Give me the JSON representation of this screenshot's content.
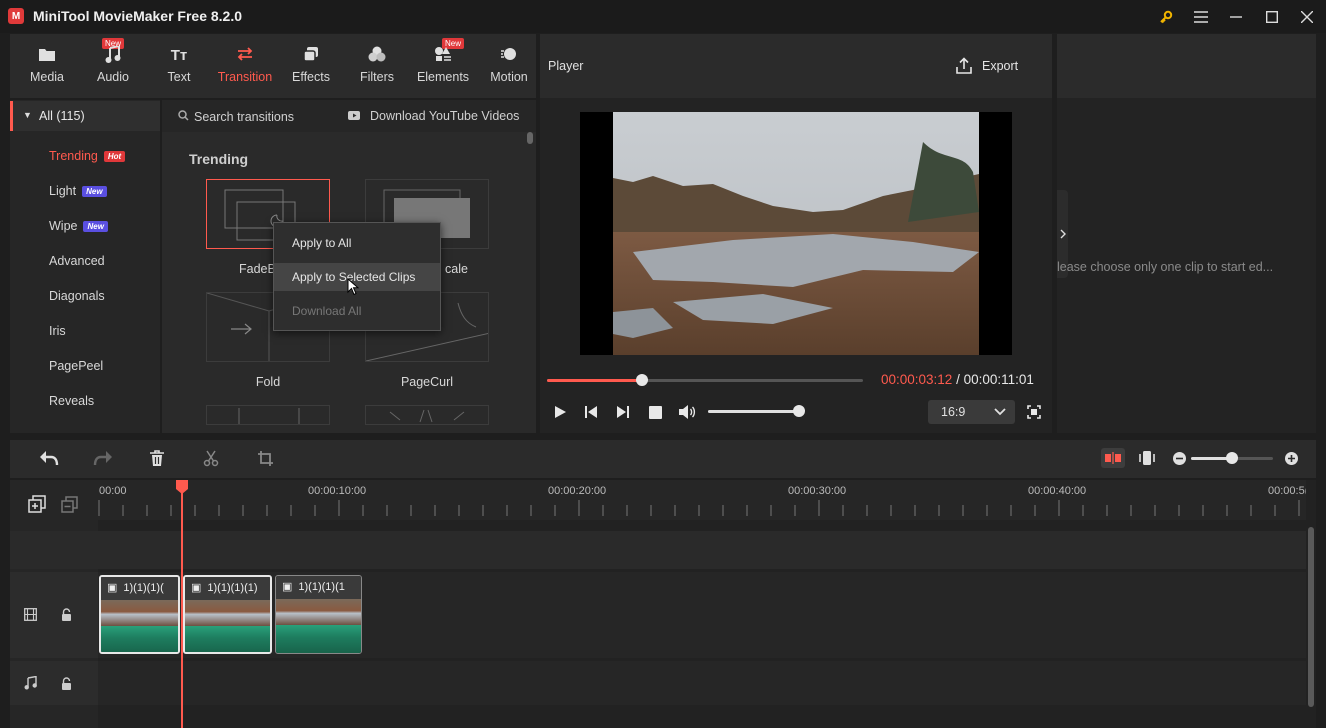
{
  "app": {
    "title": "MiniTool MovieMaker Free 8.2.0",
    "logo": "M"
  },
  "window_controls": {
    "key": "key-icon",
    "menu": "hamburger-icon"
  },
  "toolbar": {
    "tabs": [
      {
        "label": "Media",
        "icon": "media-icon",
        "badge": ""
      },
      {
        "label": "Audio",
        "icon": "audio-icon",
        "badge": "New"
      },
      {
        "label": "Text",
        "icon": "text-icon",
        "badge": ""
      },
      {
        "label": "Transition",
        "icon": "transition-icon",
        "badge": "",
        "active": true
      },
      {
        "label": "Effects",
        "icon": "effects-icon",
        "badge": ""
      },
      {
        "label": "Filters",
        "icon": "filters-icon",
        "badge": ""
      },
      {
        "label": "Elements",
        "icon": "elements-icon",
        "badge": "New"
      },
      {
        "label": "Motion",
        "icon": "motion-icon",
        "badge": ""
      }
    ]
  },
  "categories": {
    "all": "All (115)",
    "items": [
      {
        "label": "Trending",
        "tag": "Hot"
      },
      {
        "label": "Light",
        "tag": "New"
      },
      {
        "label": "Wipe",
        "tag": "New"
      },
      {
        "label": "Advanced",
        "tag": ""
      },
      {
        "label": "Diagonals",
        "tag": ""
      },
      {
        "label": "Iris",
        "tag": ""
      },
      {
        "label": "PagePeel",
        "tag": ""
      },
      {
        "label": "Reveals",
        "tag": ""
      }
    ]
  },
  "library": {
    "search_placeholder": "Search transitions",
    "download_link": "Download YouTube Videos",
    "section_title": "Trending",
    "items": [
      {
        "label": "FadeB"
      },
      {
        "label": "cale"
      },
      {
        "label": "Fold"
      },
      {
        "label": "PageCurl"
      }
    ]
  },
  "context_menu": {
    "items": [
      {
        "label": "Apply to All",
        "enabled": true
      },
      {
        "label": "Apply to Selected Clips",
        "enabled": true,
        "hover": true
      },
      {
        "label": "Download All",
        "enabled": false
      }
    ]
  },
  "player": {
    "title": "Player",
    "export_label": "Export",
    "current_time": "00:00:03:12",
    "separator": " / ",
    "total_time": "00:00:11:01",
    "progress": 0.3,
    "volume": 0.98,
    "aspect_ratio": "16:9"
  },
  "properties": {
    "hint": "lease choose only one clip to start ed..."
  },
  "timeline": {
    "ruler": [
      "00:00",
      "00:00:10:00",
      "00:00:20:00",
      "00:00:30:00",
      "00:00:40:00",
      "00:00:5("
    ],
    "clips": [
      {
        "label": "1)(1)(1)("
      },
      {
        "label": "1)(1)(1)(1)"
      },
      {
        "label": "1)(1)(1)(1"
      }
    ],
    "zoom": 0.5
  },
  "colors": {
    "accent": "#ff5a4e",
    "hot": "#e0383a",
    "new": "#5a4fe0",
    "clip_audio": "#1e7d5f"
  }
}
